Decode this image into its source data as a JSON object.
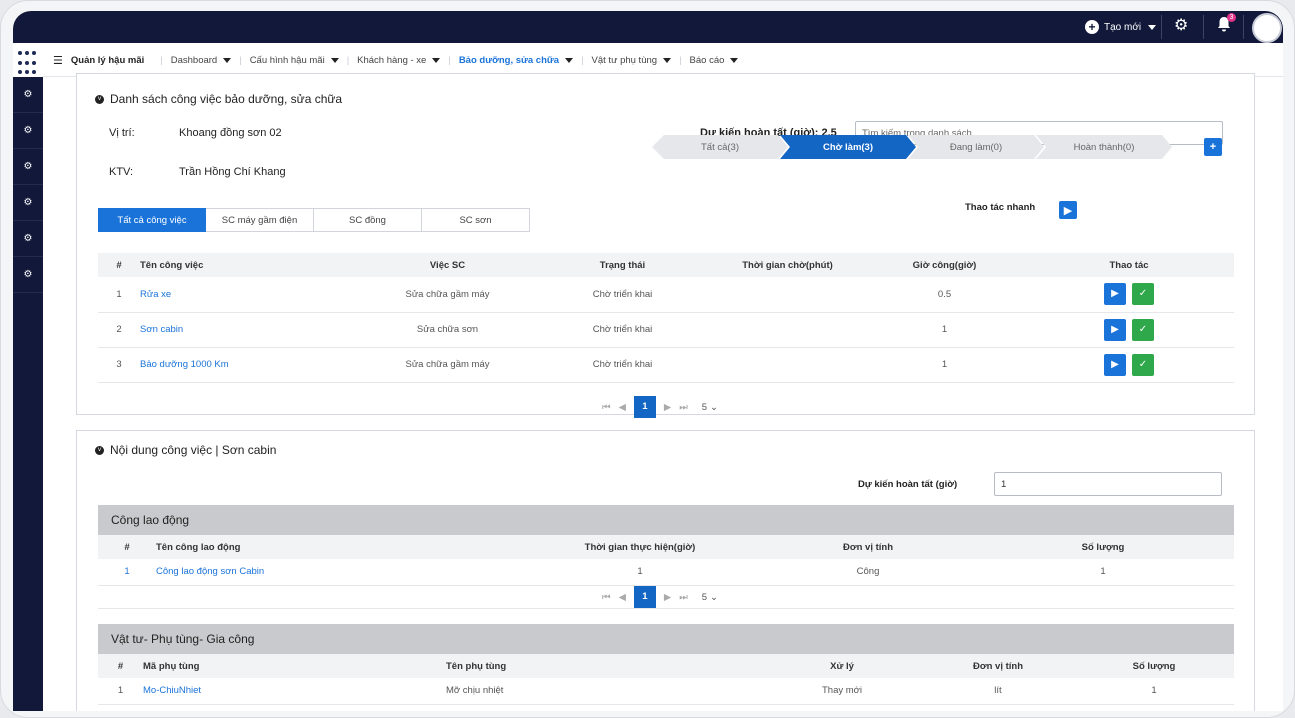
{
  "topbar": {
    "create_label": "Tạo mới",
    "notification_count": "3"
  },
  "nav": {
    "brand": "Quản lý hậu mãi",
    "items": [
      {
        "label": "Dashboard"
      },
      {
        "label": "Cấu hình hậu mãi"
      },
      {
        "label": "Khách hàng - xe"
      },
      {
        "label": "Bảo dưỡng, sửa chữa"
      },
      {
        "label": "Vật tư phụ tùng"
      },
      {
        "label": "Báo cáo"
      }
    ]
  },
  "job_list": {
    "title": "Danh sách công việc bảo dưỡng, sửa chữa",
    "location_label": "Vị trí:",
    "location_value": "Khoang đồng sơn 02",
    "tech_label": "KTV:",
    "tech_value": "Trần Hồng Chí Khang",
    "expected_label": "Dự kiến hoàn tất (giờ): 2.5",
    "search_placeholder": "Tìm kiếm trong danh sách",
    "steps": [
      "Tất cả(3)",
      "Chờ làm(3)",
      "Đang làm(0)",
      "Hoàn thành(0)"
    ],
    "quick_action_label": "Thao tác nhanh",
    "tabs": [
      "Tất cả công việc",
      "SC máy gầm điện",
      "SC đồng",
      "SC sơn"
    ],
    "columns": [
      "#",
      "Tên công việc",
      "Việc SC",
      "Trạng thái",
      "Thời gian chờ(phút)",
      "Giờ công(giờ)",
      "Thao tác"
    ],
    "rows": [
      {
        "no": "1",
        "name": "Rửa xe",
        "type": "Sửa chữa gầm máy",
        "status": "Chờ triển khai",
        "wait": "",
        "hours": "0.5"
      },
      {
        "no": "2",
        "name": "Sơn cabin",
        "type": "Sửa chữa sơn",
        "status": "Chờ triển khai",
        "wait": "",
        "hours": "1"
      },
      {
        "no": "3",
        "name": "Bảo dưỡng 1000 Km",
        "type": "Sửa chữa gầm máy",
        "status": "Chờ triển khai",
        "wait": "",
        "hours": "1"
      }
    ],
    "page": "1",
    "page_size": "5"
  },
  "job_detail": {
    "title": "Nội dung công việc | Sơn cabin",
    "expected_label": "Dự kiến hoàn tất (giờ)",
    "expected_value": "1",
    "labor": {
      "title": "Công lao động",
      "columns": [
        "#",
        "Tên công lao động",
        "Thời gian thực hiện(giờ)",
        "Đơn vị tính",
        "Số lượng"
      ],
      "rows": [
        {
          "no": "1",
          "name": "Công lao động sơn Cabin",
          "time": "1",
          "unit": "Công",
          "qty": "1"
        }
      ],
      "page": "1",
      "page_size": "5"
    },
    "parts": {
      "title": "Vật tư- Phụ tùng- Gia công",
      "columns": [
        "#",
        "Mã phụ tùng",
        "Tên phụ tùng",
        "Xử lý",
        "Đơn vị tính",
        "Số lượng"
      ],
      "rows": [
        {
          "no": "1",
          "code": "Mo-ChiuNhiet",
          "name": "Mỡ chịu nhiệt",
          "action": "Thay mới",
          "unit": "lít",
          "qty": "1"
        }
      ]
    }
  },
  "colors": {
    "topbar": "#11183a",
    "primary": "#1a73d9",
    "success": "#2ea84a"
  }
}
